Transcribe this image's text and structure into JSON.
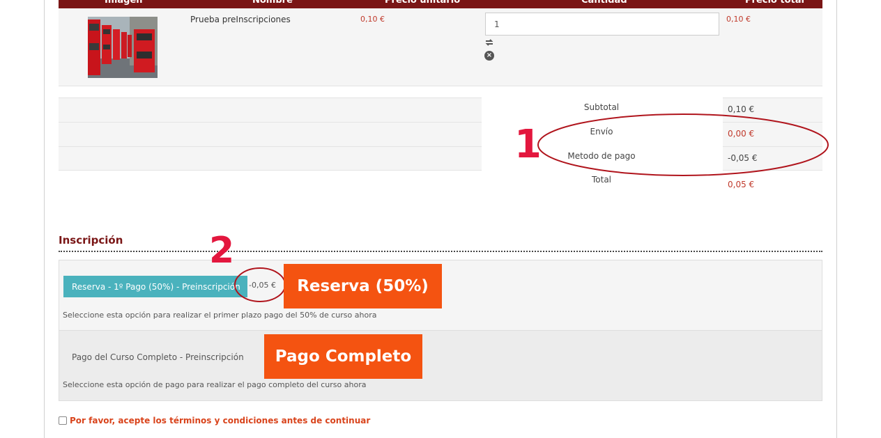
{
  "table": {
    "headers": [
      "Imagen",
      "Nombre",
      "Precio unitario",
      "Cantidad",
      "Precio total"
    ],
    "row": {
      "name": "Prueba preInscripciones",
      "unit_price": "0,10 €",
      "quantity": "1",
      "total_price": "0,10 €",
      "image_icon": "red-double-decker-bus-photo",
      "refresh_icon": "refresh-icon",
      "remove_icon": "remove-icon"
    }
  },
  "summary": {
    "rows": [
      {
        "label": "Subtotal",
        "value": "0,10 €"
      },
      {
        "label": "Envío",
        "value": "0,00 €"
      },
      {
        "label": "Metodo de pago",
        "value": "-0,05 €"
      },
      {
        "label": "Total",
        "value": "0,05 €"
      }
    ]
  },
  "annotations": {
    "one": "1",
    "two": "2"
  },
  "inscription": {
    "title": "Inscripción",
    "option1": {
      "button_label": "Reserva - 1º Pago (50%) - Preinscripción",
      "price": "-0,05 €",
      "description": "Seleccione esta opción para realizar el primer plazo pago del 50% de curso ahora",
      "badge": "Reserva (50%)"
    },
    "option2": {
      "label": "Pago del Curso Completo - Preinscripción",
      "description": "Seleccione esta opción de pago para realizar el pago completo del curso ahora",
      "badge": "Pago Completo"
    }
  },
  "terms": {
    "text": "Por favor, acepte los términos y condiciones antes de continuar"
  },
  "colors": {
    "header": "#7a1616",
    "accent_red": "#c0392b",
    "annotation": "#e3173e",
    "badge": "#f45311",
    "button": "#4ab2bd"
  }
}
